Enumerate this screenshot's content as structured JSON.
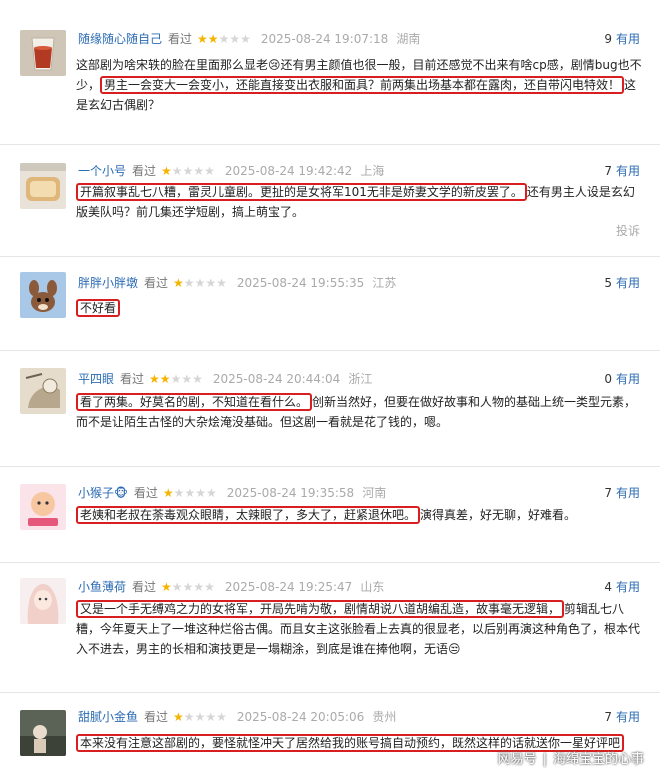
{
  "ui": {
    "watched": "看过",
    "useful": "有用",
    "report": "投诉",
    "star_full": "★",
    "star_empty": "★"
  },
  "colors": {
    "highlight_border": "#d81e1e",
    "username": "#2b6bb3",
    "star_on": "#f4b400",
    "star_off": "#d6d6d6"
  },
  "reviews": [
    {
      "user": "随缘随心随自己",
      "stars": 2,
      "time": "2025-08-24 19:07:18",
      "location": "湖南",
      "useful": "9",
      "avatar_icon": "avatar-drink-icon",
      "segments": [
        {
          "text": "这部剧为啥宋轶的脸在里面那么显老😢还有男主颜值也很一般，目前还感觉不出来有啥cp感，剧情bug也不少，",
          "hl": false
        },
        {
          "text": "男主一会变大一会变小，还能直接变出衣服和面具？前两集出场基本都在露肉，还自带闪电特效！",
          "hl": true
        },
        {
          "text": "这是玄幻古偶剧？",
          "hl": false
        }
      ]
    },
    {
      "user": "一个小号",
      "stars": 1,
      "time": "2025-08-24 19:42:42",
      "location": "上海",
      "useful": "7",
      "avatar_icon": "avatar-bread-icon",
      "segments": [
        {
          "text": "开篇叙事乱七八糟，雷灵儿童剧。更扯的是女将军101无非是娇妻文学的新皮罢了。",
          "hl": true
        },
        {
          "text": "还有男主人设是玄幻版美队吗？前几集还学短剧，搞上萌宝了。",
          "hl": false
        }
      ],
      "show_report": true
    },
    {
      "user": "胖胖小胖墩",
      "stars": 1,
      "time": "2025-08-24 19:55:35",
      "location": "江苏",
      "useful": "5",
      "avatar_icon": "avatar-deer-icon",
      "segments": [
        {
          "text": "不好看",
          "hl": true
        }
      ]
    },
    {
      "user": "平四眼",
      "stars": 2,
      "time": "2025-08-24 20:44:04",
      "location": "浙江",
      "useful": "0",
      "avatar_icon": "avatar-cartoon-icon",
      "segments": [
        {
          "text": "看了两集。好莫名的剧，不知道在看什么。",
          "hl": true
        },
        {
          "text": "创新当然好，但要在做好故事和人物的基础上统一类型元素，而不是让陌生古怪的大杂烩淹没基础。但这剧一看就是花了钱的，嗯。",
          "hl": false
        }
      ]
    },
    {
      "user": "小猴子🐵",
      "stars": 1,
      "time": "2025-08-24 19:35:58",
      "location": "河南",
      "useful": "7",
      "avatar_icon": "avatar-sticker-icon",
      "segments": [
        {
          "text": "老姨和老叔在荼毒观众眼睛，太辣眼了，多大了，赶紧退休吧。",
          "hl": true
        },
        {
          "text": "演得真差，好无聊，好难看。",
          "hl": false
        }
      ]
    },
    {
      "user": "小鱼薄荷",
      "stars": 1,
      "time": "2025-08-24 19:25:47",
      "location": "山东",
      "useful": "4",
      "avatar_icon": "avatar-girl-icon",
      "segments": [
        {
          "text": "又是一个手无缚鸡之力的女将军，开局先啃为敬，剧情胡说八道胡编乱造，故事毫无逻辑，",
          "hl": true
        },
        {
          "text": "剪辑乱七八糟，今年夏天上了一堆这种烂俗古偶。而且女主这张脸看上去真的很显老，以后别再演这种角色了，根本代入不进去，男主的长相和演技更是一塌糊涂，到底是谁在捧他啊，无语😒",
          "hl": false
        }
      ]
    },
    {
      "user": "甜腻小金鱼",
      "stars": 1,
      "time": "2025-08-24 20:05:06",
      "location": "贵州",
      "useful": "7",
      "avatar_icon": "avatar-photo-icon",
      "segments": [
        {
          "text": "本来没有注意这部剧的，要怪就怪冲天了居然给我的账号搞自动预约，既然这样的话就送你一星好评吧",
          "hl": true
        }
      ]
    }
  ],
  "watermark": {
    "brand": "网易号",
    "divider": "|",
    "author": "海绵宝宝的心事"
  }
}
